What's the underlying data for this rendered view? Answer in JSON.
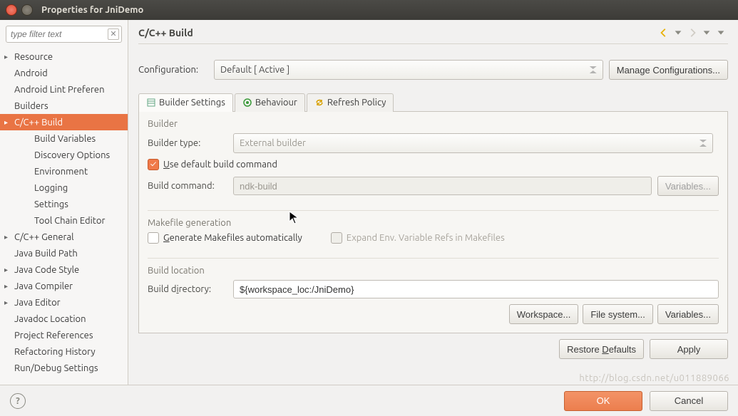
{
  "window": {
    "title": "Properties for JniDemo"
  },
  "filter": {
    "placeholder": "type filter text"
  },
  "tree": [
    {
      "label": "Resource",
      "expand": true
    },
    {
      "label": "Android"
    },
    {
      "label": "Android Lint Preferen"
    },
    {
      "label": "Builders"
    },
    {
      "label": "C/C++ Build",
      "expand": true,
      "selected": true
    },
    {
      "label": "Build Variables",
      "child": true
    },
    {
      "label": "Discovery Options",
      "child": true
    },
    {
      "label": "Environment",
      "child": true
    },
    {
      "label": "Logging",
      "child": true
    },
    {
      "label": "Settings",
      "child": true
    },
    {
      "label": "Tool Chain Editor",
      "child": true
    },
    {
      "label": "C/C++ General",
      "expand": true
    },
    {
      "label": "Java Build Path"
    },
    {
      "label": "Java Code Style",
      "expand": true
    },
    {
      "label": "Java Compiler",
      "expand": true
    },
    {
      "label": "Java Editor",
      "expand": true
    },
    {
      "label": "Javadoc Location"
    },
    {
      "label": "Project References"
    },
    {
      "label": "Refactoring History"
    },
    {
      "label": "Run/Debug Settings"
    }
  ],
  "page": {
    "title": "C/C++ Build",
    "config_label": "Configuration:",
    "config_value": "Default  [ Active ]",
    "manage_btn": "Manage Configurations...",
    "tabs": [
      "Builder Settings",
      "Behaviour",
      "Refresh Policy"
    ],
    "builder": {
      "group": "Builder",
      "type_label": "Builder type:",
      "type_value": "External builder",
      "use_default_label_pre": "U",
      "use_default_label": "se default build command",
      "cmd_label": "Build command:",
      "cmd_value": "ndk-build",
      "variables_btn": "Variables..."
    },
    "makefile": {
      "group": "Makefile generation",
      "gen_pre": "G",
      "gen_label": "enerate Makefiles automatically",
      "expand_label": "Expand Env. Variable Refs in Makefiles"
    },
    "location": {
      "group": "Build location",
      "dir_label_pre": "Build d",
      "dir_label_u": "i",
      "dir_label_post": "rectory:",
      "dir_value": "${workspace_loc:/JniDemo}",
      "workspace_btn": "Workspace...",
      "filesystem_btn": "File system...",
      "variables_btn": "Variables..."
    },
    "restore_btn_pre": "Restore ",
    "restore_btn_u": "D",
    "restore_btn_post": "efaults",
    "apply_btn": "Apply"
  },
  "bottom": {
    "ok": "OK",
    "cancel": "Cancel"
  },
  "watermark": "http://blog.csdn.net/u011889066"
}
